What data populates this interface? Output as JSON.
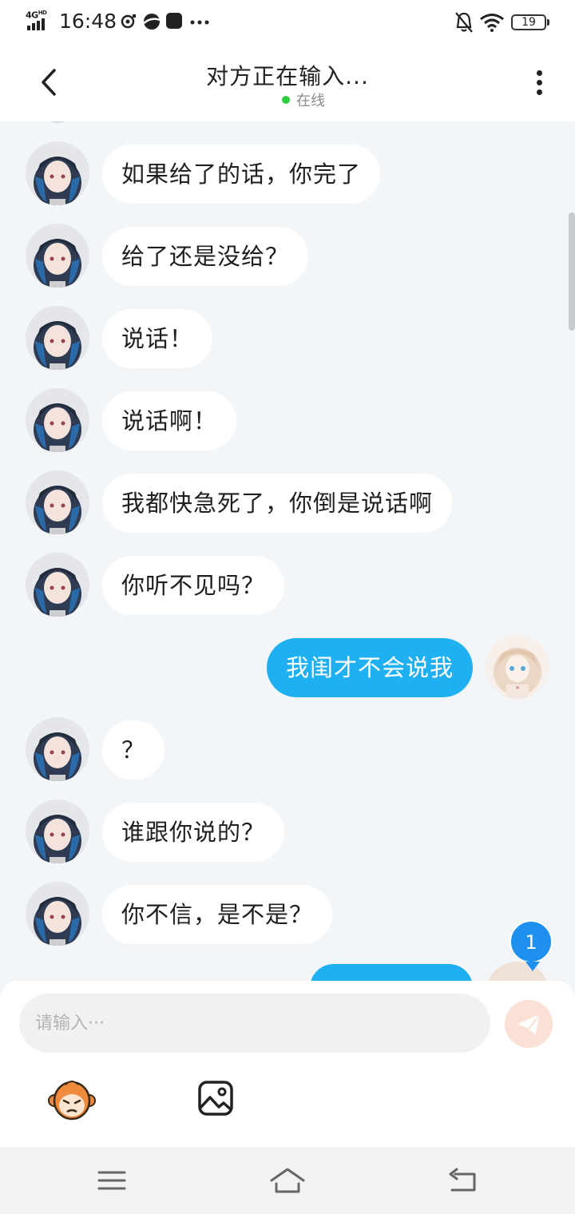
{
  "status_bar": {
    "network": "4G",
    "network_sup": "HD",
    "time": "16:48",
    "battery": "19",
    "icons": [
      "signal-icon",
      "notification-app-icon",
      "planet-app-icon",
      "app-square-icon",
      "more-notifications-icon",
      "mute-bell-icon",
      "wifi-icon",
      "battery-icon"
    ]
  },
  "header": {
    "title": "对方正在输入...",
    "status": "在线",
    "status_color": "#2ecc40",
    "icons": [
      "back-arrow-icon",
      "more-vertical-icon"
    ]
  },
  "messages": [
    {
      "side": "left",
      "text": "如果给了的话，你完了"
    },
    {
      "side": "left",
      "text": "给了还是没给？"
    },
    {
      "side": "left",
      "text": "说话！"
    },
    {
      "side": "left",
      "text": "说话啊！"
    },
    {
      "side": "left",
      "text": "我都快急死了，你倒是说话啊"
    },
    {
      "side": "left",
      "text": "你听不见吗？"
    },
    {
      "side": "right",
      "text": "我闺才不会说我"
    },
    {
      "side": "left",
      "text": "？"
    },
    {
      "side": "left",
      "text": "谁跟你说的？"
    },
    {
      "side": "left",
      "text": "你不信，是不是？"
    }
  ],
  "unread_badge": "1",
  "colors": {
    "my_bubble": "#1fb0f2",
    "their_bubble": "#ffffff",
    "background": "#f3f6f8",
    "badge": "#1e90f0",
    "send_button": "#fbe0d6"
  },
  "input": {
    "placeholder": "请输入···",
    "value": ""
  },
  "toolbar": {
    "icons": [
      "monkey-emoji-icon",
      "image-icon",
      "send-plane-icon"
    ]
  },
  "nav_bar": {
    "icons": [
      "menu-icon",
      "home-icon",
      "back-icon"
    ]
  }
}
